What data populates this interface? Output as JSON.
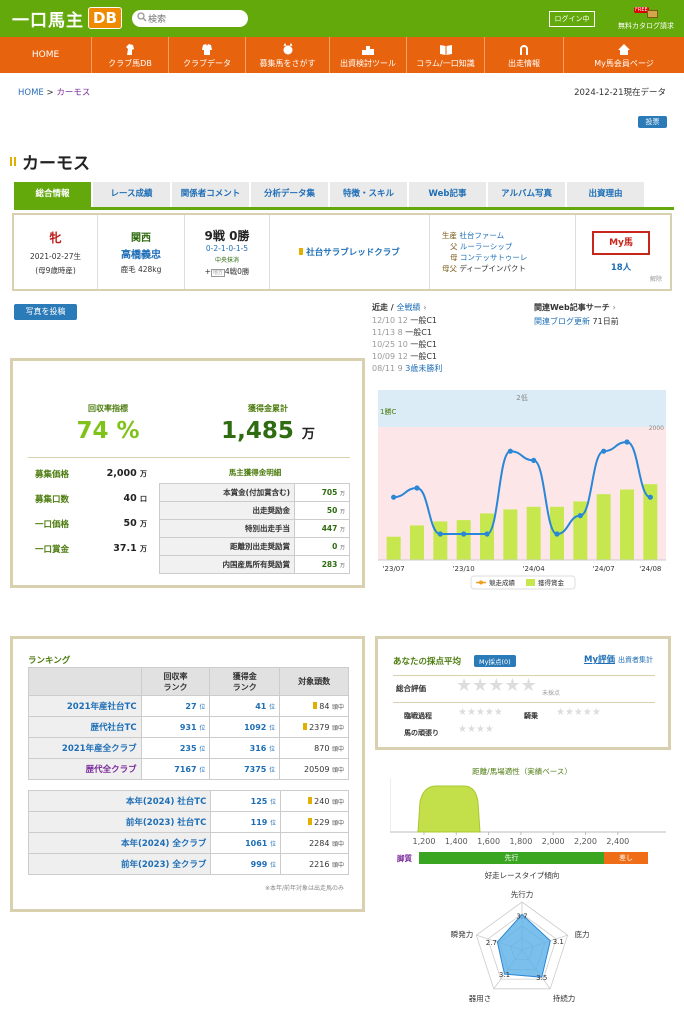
{
  "header": {
    "logo_text": "一口馬主",
    "logo_badge": "DB",
    "search_placeholder": "検索",
    "login": "ログイン中",
    "catalog": "無料カタログ請求",
    "catalog_badge": "FREE"
  },
  "nav": [
    "HOME",
    "クラブ馬DB",
    "クラブデータ",
    "募集馬をさがす",
    "出資検討ツール",
    "コラム/一口知識",
    "出走情報",
    "My馬会員ページ"
  ],
  "breadcrumb": {
    "home": "HOME",
    "sep": " > ",
    "current": "カーモス"
  },
  "as_of": "2024-12-21現在データ",
  "vote": "投票",
  "horse_name": "カーモス",
  "tabs": [
    "総合情報",
    "レース成績",
    "関係者コメント",
    "分析データ集",
    "特徴・スキル",
    "Web記事",
    "アルバム写真",
    "出資理由"
  ],
  "summary": {
    "sex": "牝",
    "birth": "2021-02-27生",
    "age": "(母9歳時産)",
    "region": "関西",
    "trainer": "高橋義忠",
    "color_weight": "鹿毛 428kg",
    "record": "9戦 0勝",
    "record_detail": "0-2-1-0-1-5",
    "record_sub": "中央抹消",
    "record_extra_prefix": "+",
    "record_extra_badge": "地方",
    "record_extra": "4戦0勝",
    "club": "社台サラブレッドクラブ",
    "breeder_k": "生産",
    "breeder": "社台ファーム",
    "sire_k": "父",
    "sire": "ルーラーシップ",
    "dam_k": "母",
    "dam": "コンテッサトゥーレ",
    "damsire_k": "母父",
    "damsire": "ディープインパクト",
    "my_label": "My馬",
    "my_count": "18人",
    "release": "解除"
  },
  "photo_btn": "写真を投稿",
  "recent": {
    "title": "近走",
    "sep": " / ",
    "all": "全戦績",
    "rows": [
      {
        "date": "12/10",
        "pos": "12",
        "race": "一般C1"
      },
      {
        "date": "11/13",
        "pos": "8",
        "race": "一般C1"
      },
      {
        "date": "10/25",
        "pos": "10",
        "race": "一般C1"
      },
      {
        "date": "10/09",
        "pos": "12",
        "race": "一般C1"
      },
      {
        "date": "08/11",
        "pos": "9",
        "race": "3歳未勝利"
      }
    ]
  },
  "related": {
    "title": "関連Web記事サーチ",
    "blog": "関連ブログ更新",
    "blog_when": "71日前"
  },
  "stats": {
    "roi_label": "回収率指標",
    "roi": "74",
    "roi_unit": "%",
    "earn_label": "獲得金累計",
    "earn": "1,485",
    "earn_unit": "万",
    "items": [
      {
        "k": "募集価格",
        "v": "2,000",
        "u": "万"
      },
      {
        "k": "募集口数",
        "v": "40",
        "u": "口"
      },
      {
        "k": "一口価格",
        "v": "50",
        "u": "万"
      },
      {
        "k": "一口賞金",
        "v": "37.1",
        "u": "万"
      }
    ],
    "breakdown_title": "馬主獲得金明細",
    "breakdown": [
      {
        "k": "本賞金(付加賞含む)",
        "v": "705",
        "u": "万"
      },
      {
        "k": "出走奨励金",
        "v": "50",
        "u": "万"
      },
      {
        "k": "特別出走手当",
        "v": "447",
        "u": "万"
      },
      {
        "k": "距離別出走奨励賞",
        "v": "0",
        "u": "万"
      },
      {
        "k": "内国産馬所有奨励賞",
        "v": "283",
        "u": "万"
      }
    ]
  },
  "chart_data": {
    "type": "bar",
    "title": "",
    "categories": [
      "'23/07",
      "",
      "",
      "'23/10",
      "",
      "",
      "'24/04",
      "",
      "",
      "'24/07",
      "",
      "'24/08"
    ],
    "series": [
      {
        "name": "獲得賞金",
        "values": [
          350,
          520,
          580,
          600,
          700,
          760,
          800,
          800,
          880,
          990,
          1060,
          1140
        ]
      },
      {
        "name": "競走成績",
        "values": [
          8,
          7,
          12,
          12,
          12,
          3,
          4,
          12,
          10,
          3,
          2,
          8
        ]
      }
    ],
    "labels": {
      "top": "2低",
      "left": "1勝C",
      "right": "2000"
    },
    "legend": [
      "競走成績",
      "獲得賞金"
    ],
    "ylim": [
      0,
      2000
    ]
  },
  "ranking": {
    "title": "ランキング",
    "cols": [
      "回収率\nランク",
      "獲得金\nランク",
      "対象頭数"
    ],
    "rows1": [
      {
        "k": "2021年産社台TC",
        "a": "27",
        "b": "41",
        "c": "84",
        "badge": true,
        "purple": false
      },
      {
        "k": "歴代社台TC",
        "a": "931",
        "b": "1092",
        "c": "2379",
        "badge": true,
        "purple": false
      },
      {
        "k": "2021年産全クラブ",
        "a": "235",
        "b": "316",
        "c": "870",
        "badge": false,
        "purple": false
      },
      {
        "k": "歴代全クラブ",
        "a": "7167",
        "b": "7375",
        "c": "20509",
        "badge": false,
        "purple": true
      }
    ],
    "rows2": [
      {
        "k": "本年(2024) 社台TC",
        "a": "125",
        "c": "240",
        "badge": true
      },
      {
        "k": "前年(2023) 社台TC",
        "a": "119",
        "c": "229",
        "badge": true
      },
      {
        "k": "本年(2024) 全クラブ",
        "a": "1061",
        "c": "2284",
        "badge": false
      },
      {
        "k": "前年(2023) 全クラブ",
        "a": "999",
        "c": "2216",
        "badge": false
      }
    ],
    "unit_rank": "位",
    "unit_head": "頭中",
    "note": "※本年/前年対象は出走馬のみ"
  },
  "score": {
    "title": "あなたの採点平均",
    "badge": "My採点(0)",
    "my_eval": "My評価",
    "invest_total": "出資者集計",
    "overall": "総合評価",
    "unrated": "未採点",
    "rows": [
      {
        "k": "臨戦過程"
      },
      {
        "k": "騎乗"
      },
      {
        "k": "馬の頑張り"
      }
    ]
  },
  "distance": {
    "title": "距離/馬場適性（実績ベース）",
    "ticks": [
      "1,200",
      "1,400",
      "1,600",
      "1,800",
      "2,000",
      "2,200",
      "2,400"
    ]
  },
  "style": {
    "label": "脚質",
    "a": "先行",
    "b": "差し"
  },
  "radar": {
    "title": "好走レースタイプ傾向",
    "axes": [
      {
        "name": "先行力",
        "v": "3.7"
      },
      {
        "name": "底力",
        "v": "3.1"
      },
      {
        "name": "持続力",
        "v": "3.5"
      },
      {
        "name": "器用さ",
        "v": "3.1"
      },
      {
        "name": "瞬発力",
        "v": "2.7"
      }
    ]
  }
}
